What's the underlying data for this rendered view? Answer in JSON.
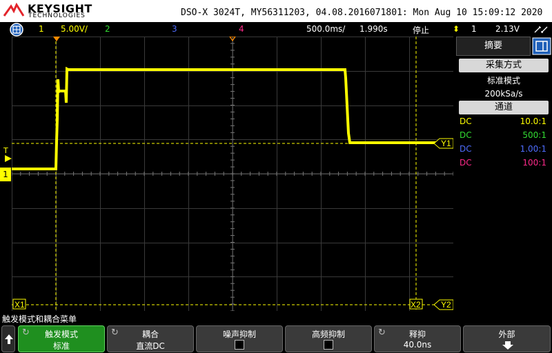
{
  "header": {
    "brand": "KEYSIGHT",
    "brand_sub": "TECHNOLOGIES",
    "model_line": "DSO-X 3024T, MY56311203, 04.08.2016071801: Mon Aug 10 15:09:12 2020"
  },
  "statusbar": {
    "ch1_num": "1",
    "ch1_scale": "5.00V/",
    "ch2_num": "2",
    "ch3_num": "3",
    "ch4_num": "4",
    "timebase": "500.0ms/",
    "delay": "1.990s",
    "run_state": "停止",
    "trig_source": "1",
    "trig_level": "2.13V"
  },
  "plot": {
    "trig_marker": "T",
    "ch1_marker": "1",
    "cursor_x1": "X1",
    "cursor_x2": "X2",
    "cursor_y1": "Y1",
    "cursor_y2": "Y2"
  },
  "right_panel": {
    "title": "摘要",
    "acq_header": "采集方式",
    "acq_mode": "标准模式",
    "sample_rate": "200kSa/s",
    "channel_header": "通道",
    "channels": [
      {
        "coupling": "DC",
        "probe": "10.0:1",
        "color": "#ffff00"
      },
      {
        "coupling": "DC",
        "probe": "500:1",
        "color": "#33dd33"
      },
      {
        "coupling": "DC",
        "probe": "1.00:1",
        "color": "#4f6dff"
      },
      {
        "coupling": "DC",
        "probe": "100:1",
        "color": "#ff2a8a"
      }
    ]
  },
  "softkeys": {
    "menu_title": "触发模式和耦合菜单",
    "mode_label": "触发模式",
    "mode_value": "标准",
    "coupling_label": "耦合",
    "coupling_value": "直流DC",
    "noise_label": "噪声抑制",
    "hf_label": "高频抑制",
    "holdoff_label": "释抑",
    "holdoff_value": "40.0ns",
    "external_label": "外部"
  },
  "colors": {
    "ch1": "#ffff00",
    "ch2": "#33dd33",
    "ch3": "#4f6dff",
    "ch4": "#ff2a8a",
    "softkey_active": "#1f8f1f"
  }
}
